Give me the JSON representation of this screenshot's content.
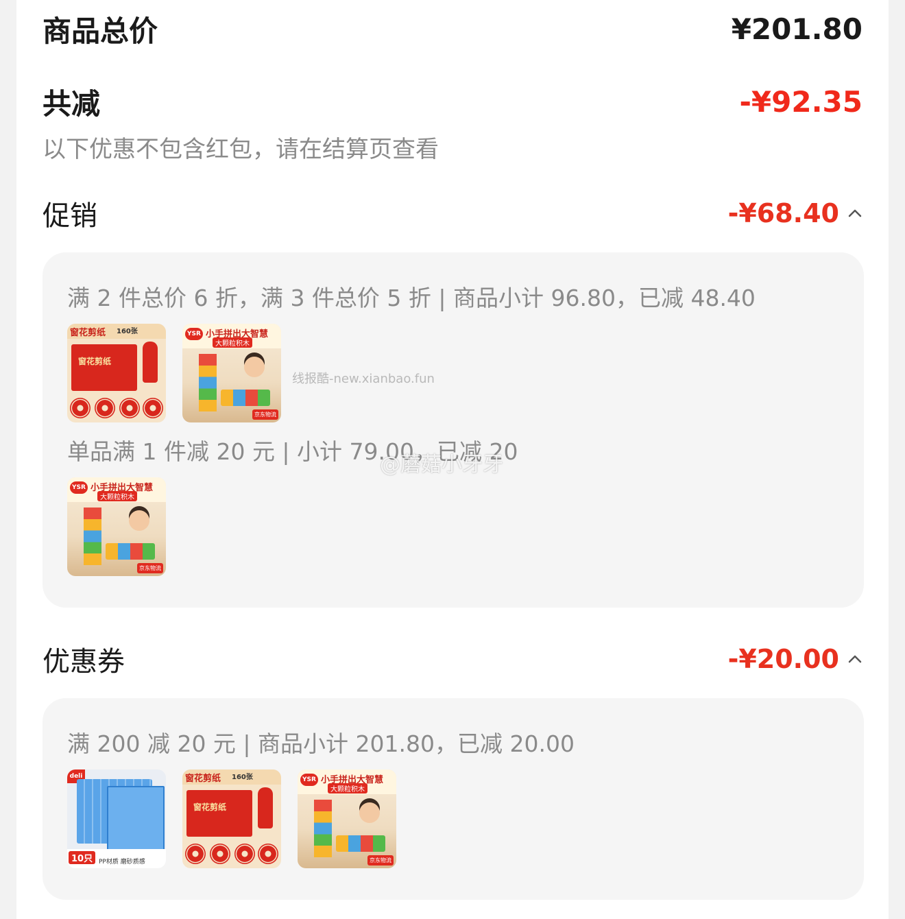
{
  "summary": {
    "total_label": "商品总价",
    "total_value": "¥201.80",
    "saved_label": "共减",
    "saved_value": "-¥92.35",
    "note": "以下优惠不包含红包，请在结算页查看"
  },
  "promotion": {
    "label": "促销",
    "value": "-¥68.40",
    "rules": [
      "满 2 件总价 6 折，满 3 件总价 5 折 | 商品小计 96.80，已减 48.40",
      "单品满 1 件减 20 元 | 小计 79.00，已减 20"
    ]
  },
  "coupon": {
    "label": "优惠券",
    "value": "-¥20.00",
    "rules": [
      "满 200 减 20 元 | 商品小计 201.80，已减 20.00"
    ]
  },
  "products": {
    "paper_cut": {
      "title": "窗花剪纸",
      "count": "160张",
      "box": "窗花剪纸"
    },
    "blocks": {
      "logo": "YSR",
      "title": "小手拼出大智慧",
      "tag": "大颗粒积木",
      "badge": "京东物流"
    },
    "folder": {
      "logo": "deli",
      "count": "10只",
      "material": "PP材质 磨砂质感"
    }
  },
  "watermarks": {
    "site": "线报酷-new.xianbao.fun",
    "weibo": "@蘑菇小牙牙"
  },
  "colors": {
    "accent": "#e8311f",
    "muted": "#8a8a8a",
    "panel": "#f5f5f5"
  }
}
